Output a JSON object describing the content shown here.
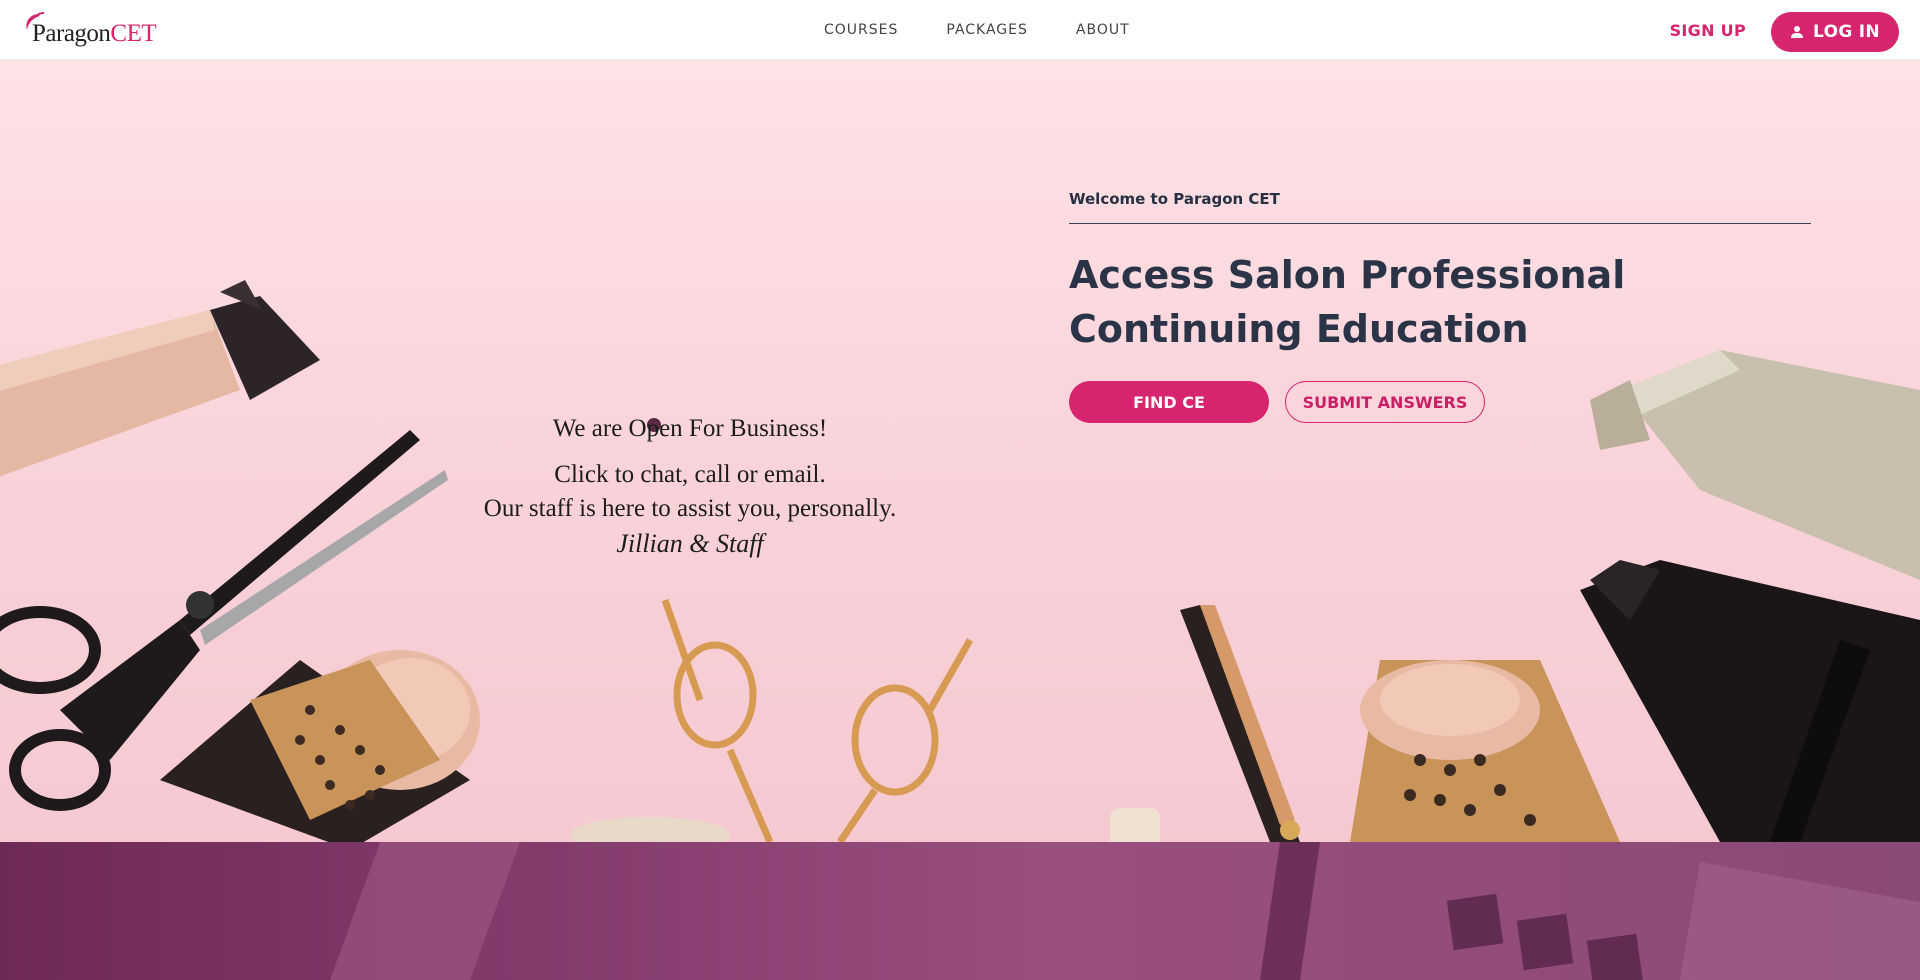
{
  "brand": {
    "name_part1": "Paragon",
    "name_part2": "CET",
    "accent_color": "#d6246e"
  },
  "nav": {
    "items": [
      {
        "label": "COURSES"
      },
      {
        "label": "PACKAGES"
      },
      {
        "label": "ABOUT"
      }
    ]
  },
  "auth": {
    "signup_label": "SIGN UP",
    "login_label": "LOG IN",
    "login_icon": "user-icon"
  },
  "notice": {
    "line1": "We are Open For Business!",
    "line2": "Click to chat, call or email.",
    "line3": "Our staff is here to assist you, personally.",
    "signature": "Jillian & Staff"
  },
  "hero": {
    "eyebrow": "Welcome to Paragon CET",
    "headline": "Access Salon Professional Continuing Education",
    "primary_button": "FIND CE",
    "secondary_button": "SUBMIT ANSWERS"
  }
}
